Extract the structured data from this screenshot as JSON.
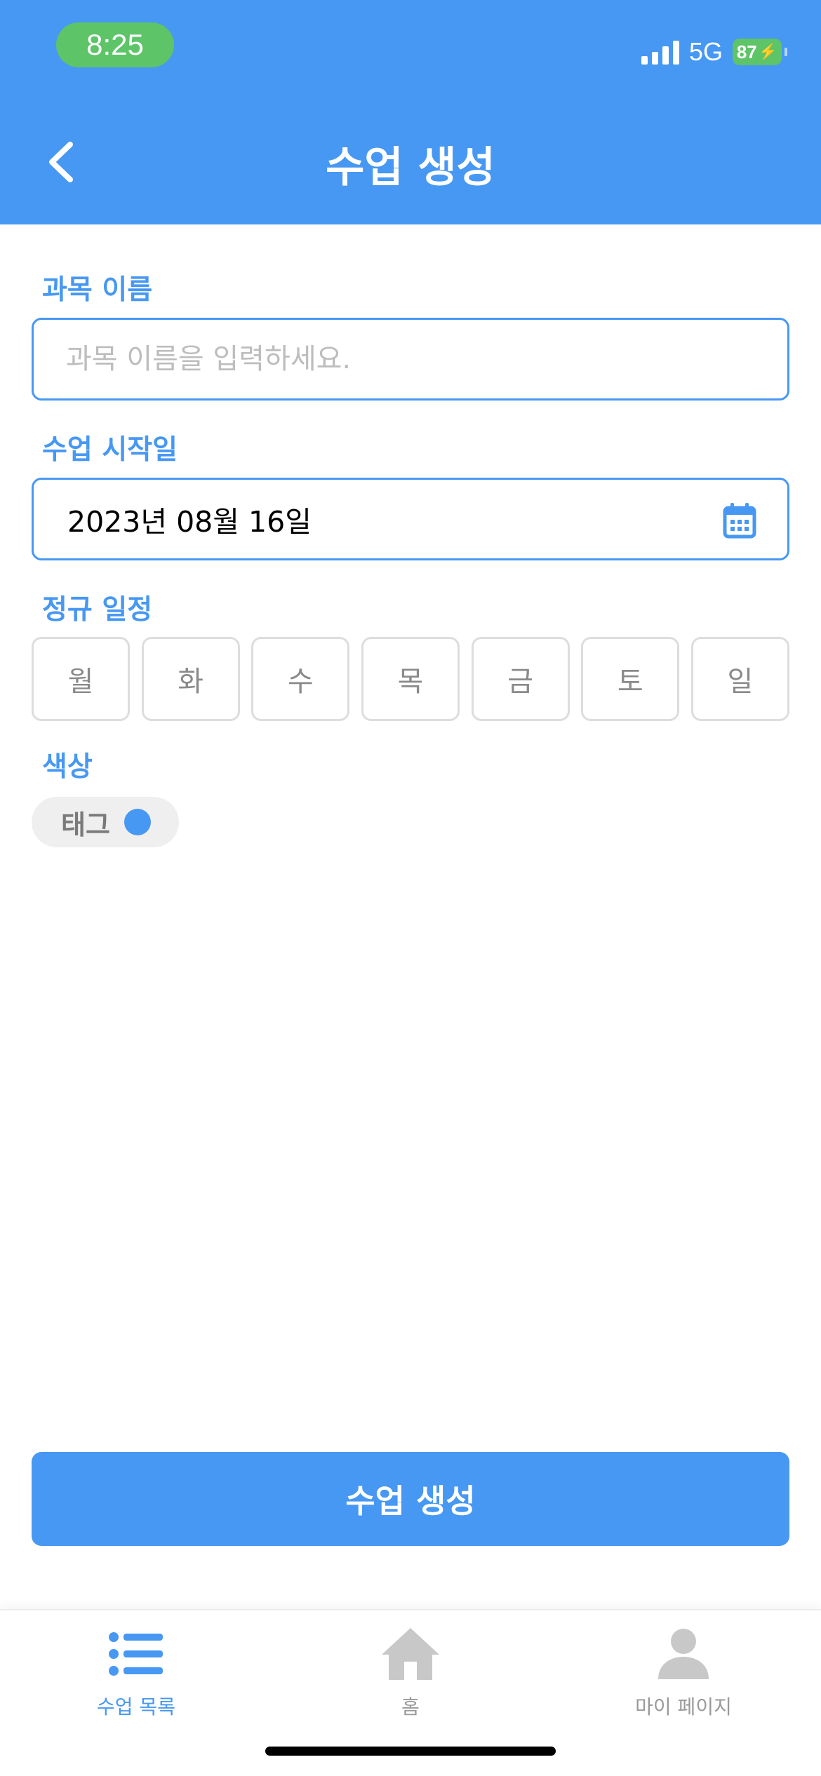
{
  "status_bar": {
    "time": "8:25",
    "network": "5G",
    "battery": "87"
  },
  "header": {
    "title": "수업 생성"
  },
  "form": {
    "subject": {
      "label": "과목 이름",
      "placeholder": "과목 이름을 입력하세요.",
      "value": ""
    },
    "start_date": {
      "label": "수업 시작일",
      "value": "2023년 08월 16일"
    },
    "schedule": {
      "label": "정규 일정",
      "days": [
        "월",
        "화",
        "수",
        "목",
        "금",
        "토",
        "일"
      ]
    },
    "color": {
      "label": "색상",
      "tag_label": "태그",
      "tag_color": "#4798F2"
    }
  },
  "create_button": {
    "label": "수업 생성"
  },
  "tabbar": {
    "items": [
      {
        "label": "수업 목록",
        "icon": "list-icon",
        "active": true
      },
      {
        "label": "홈",
        "icon": "home-icon",
        "active": false
      },
      {
        "label": "마이 페이지",
        "icon": "person-icon",
        "active": false
      }
    ]
  },
  "colors": {
    "primary": "#4798F2",
    "status_green": "#5DC468",
    "inactive": "#9A9A9A"
  }
}
